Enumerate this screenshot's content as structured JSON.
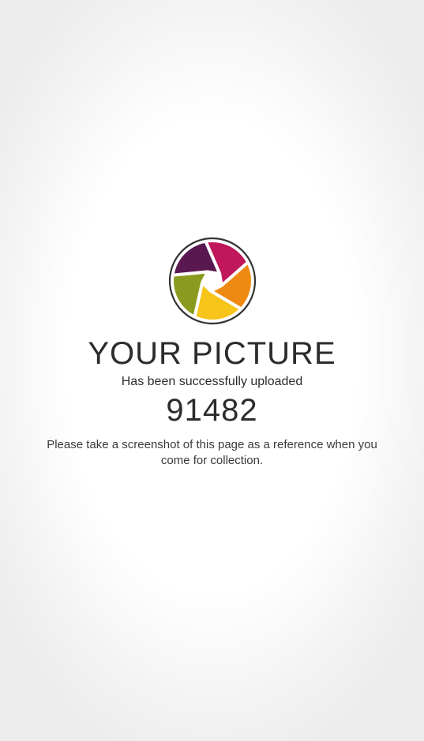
{
  "logo": {
    "icon": "camera-shutter-logo-icon",
    "colors": [
      "#c0175a",
      "#ee8a12",
      "#f7c41a",
      "#8a9a1e",
      "#5a1850"
    ],
    "ring_color": "#333333"
  },
  "main": {
    "title": "YOUR PICTURE",
    "subtitle": "Has been successfully uploaded",
    "reference_code": "91482",
    "note": "Please take a screenshot of this page as a reference when you come for collection."
  }
}
